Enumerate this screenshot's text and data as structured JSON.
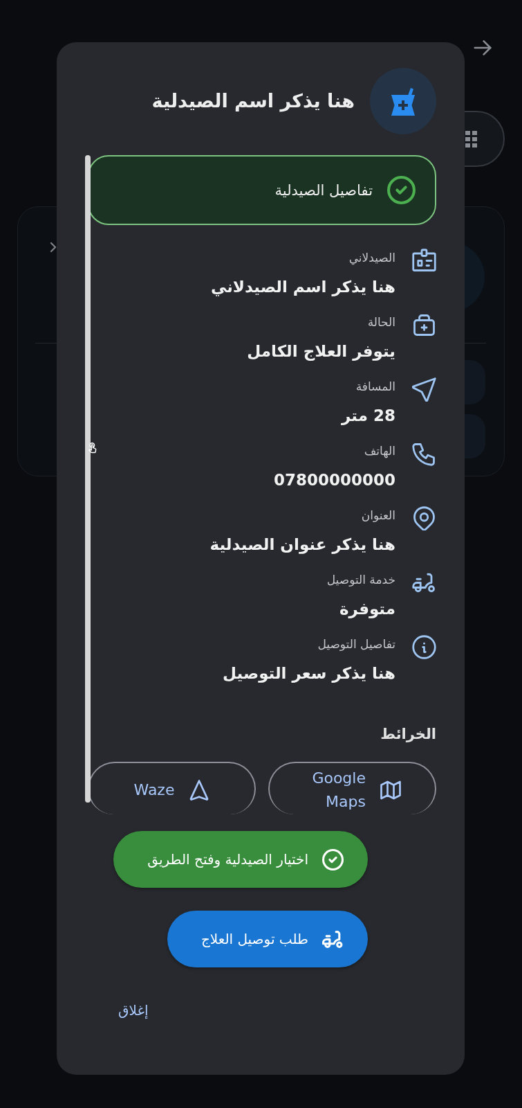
{
  "dialog": {
    "title": "هنا يذكر اسم الصيدلية",
    "banner": {
      "label": "تفاصيل الصيدلية"
    },
    "details": [
      {
        "kind": "pharmacist",
        "label": "الصيدلاني",
        "value": "هنا يذكر اسم الصيدلاني"
      },
      {
        "kind": "status",
        "label": "الحالة",
        "value": "يتوفر العلاج الكامل"
      },
      {
        "kind": "distance",
        "label": "المسافة",
        "value": "28 متر"
      },
      {
        "kind": "phone",
        "label": "الهاتف",
        "value": "07800000000"
      },
      {
        "kind": "address",
        "label": "العنوان",
        "value": "هنا يذكر عنوان الصيدلية"
      },
      {
        "kind": "delivery",
        "label": "خدمة التوصيل",
        "value": "متوفرة"
      },
      {
        "kind": "delivery_details",
        "label": "تفاصيل التوصيل",
        "value": "هنا يذكر سعر التوصيل"
      }
    ],
    "maps": {
      "heading": "الخرائط",
      "buttons": [
        {
          "kind": "google_maps",
          "label": "Google Maps"
        },
        {
          "kind": "waze",
          "label": "Waze"
        }
      ]
    },
    "actions": [
      {
        "kind": "select",
        "label": "اختيار الصيدلية وفتح الطريق"
      },
      {
        "kind": "delivery",
        "label": "طلب توصيل العلاج"
      }
    ],
    "close": "إغلاق"
  }
}
